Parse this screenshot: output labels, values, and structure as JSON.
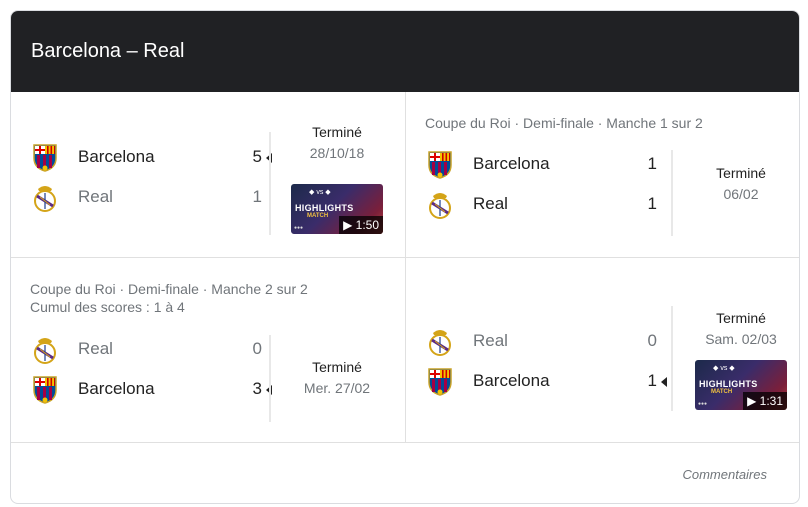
{
  "header": {
    "title": "Barcelona – Real"
  },
  "matches": [
    {
      "competition": "",
      "aggregate": "",
      "home": {
        "name": "Barcelona",
        "score": "5",
        "winner": true
      },
      "away": {
        "name": "Real",
        "score": "1",
        "winner": false
      },
      "status": "Terminé",
      "date": "28/10/18",
      "video": {
        "label": "HIGHLIGHTS",
        "sub": "MATCH",
        "duration": "▶ 1:50"
      }
    },
    {
      "competition": "Coupe du Roi · Demi-finale · Manche 1 sur 2",
      "aggregate": "",
      "home": {
        "name": "Barcelona",
        "score": "1",
        "winner": false
      },
      "away": {
        "name": "Real",
        "score": "1",
        "winner": false
      },
      "status": "Terminé",
      "date": "06/02"
    },
    {
      "competition": "Coupe du Roi · Demi-finale · Manche 2 sur 2",
      "aggregate": "Cumul des scores : 1 à 4",
      "home": {
        "name": "Real",
        "score": "0",
        "winner": false
      },
      "away": {
        "name": "Barcelona",
        "score": "3",
        "winner": true
      },
      "status": "Terminé",
      "date": "Mer. 27/02"
    },
    {
      "competition": "",
      "aggregate": "",
      "home": {
        "name": "Real",
        "score": "0",
        "winner": false
      },
      "away": {
        "name": "Barcelona",
        "score": "1",
        "winner": true
      },
      "status": "Terminé",
      "date": "Sam. 02/03",
      "video": {
        "label": "HIGHLIGHTS",
        "sub": "MATCH",
        "duration": "▶ 1:31"
      }
    }
  ],
  "footer": {
    "link": "Commentaires"
  },
  "icons": {
    "barcelona": "barcelona-crest-icon",
    "real": "real-madrid-crest-icon",
    "play": "play-icon"
  },
  "colors": {
    "header_bg": "#202124",
    "barca_blue": "#004d98",
    "barca_red": "#a50044",
    "real_gold": "#d4a418"
  }
}
